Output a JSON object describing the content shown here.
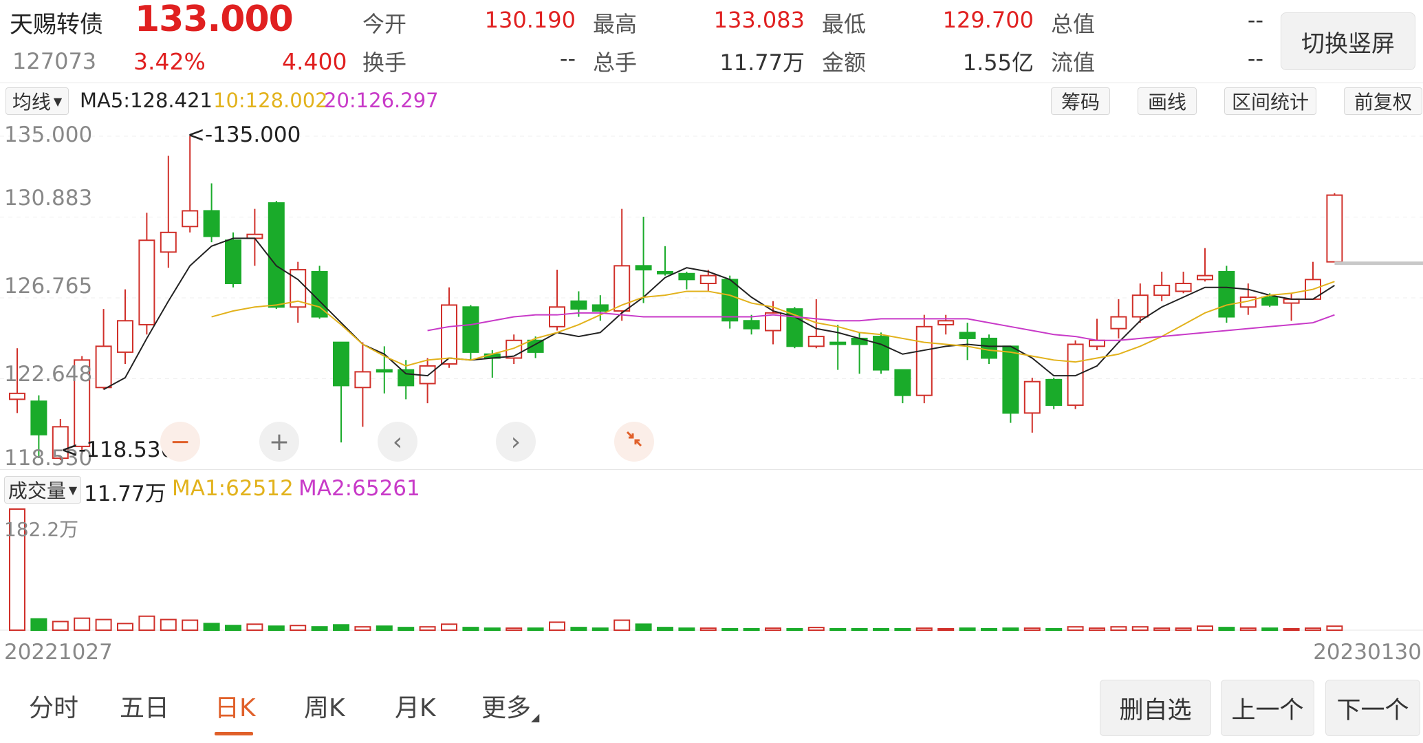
{
  "header": {
    "name": "天赐转债",
    "price": "133.000",
    "code": "127073",
    "change_pct": "3.42%",
    "change_amt": "4.400",
    "switch_label": "切换竖屏",
    "stats_row1": [
      {
        "label": "今开",
        "value": "130.190"
      },
      {
        "label": "最高",
        "value": "133.083"
      },
      {
        "label": "最低",
        "value": "129.700"
      },
      {
        "label": "总值",
        "value": "--"
      }
    ],
    "stats_row2": [
      {
        "label": "换手",
        "value": "--"
      },
      {
        "label": "总手",
        "value": "11.77万"
      },
      {
        "label": "金额",
        "value": "1.55亿"
      },
      {
        "label": "流值",
        "value": "--"
      }
    ]
  },
  "toolbar": {
    "ma_select": "均线",
    "ma5": "MA5:128.421",
    "ma10": "10:128.002",
    "ma20": "20:126.297",
    "chips": "筹码",
    "draw": "画线",
    "range_stats": "区间统计",
    "adjust": "前复权"
  },
  "price_axis": [
    "135.000",
    "130.883",
    "126.765",
    "122.648",
    "118.530"
  ],
  "annotations": {
    "high": "<-135.000",
    "low": "<-118.530"
  },
  "volume_bar": {
    "select": "成交量",
    "total": "11.77万",
    "ma1": "MA1:62512",
    "ma2": "MA2:65261",
    "axis_max": "182.2万"
  },
  "dates": {
    "start": "20221027",
    "end": "20230130"
  },
  "tabs": [
    "分时",
    "五日",
    "日K",
    "周K",
    "月K",
    "更多"
  ],
  "active_tab": "日K",
  "bottom_buttons": {
    "delete": "删自选",
    "prev": "上一个",
    "next": "下一个"
  },
  "colors": {
    "up": "#d0302a",
    "down": "#1aab2a",
    "ma5": "#222222",
    "ma10": "#e2b21c",
    "ma20": "#c83ac8"
  },
  "chart_data": {
    "type": "candlestick",
    "ylim": [
      118.53,
      135.0
    ],
    "volume_max_wan": 182.2,
    "candles": [
      {
        "o": 121.6,
        "c": 121.9,
        "h": 124.2,
        "l": 120.9,
        "v": 182.2
      },
      {
        "o": 121.5,
        "c": 119.8,
        "h": 121.8,
        "l": 118.6,
        "v": 17
      },
      {
        "o": 118.6,
        "c": 120.2,
        "h": 120.6,
        "l": 118.5,
        "v": 13
      },
      {
        "o": 119.2,
        "c": 123.6,
        "h": 123.8,
        "l": 118.8,
        "v": 18
      },
      {
        "o": 122.2,
        "c": 124.3,
        "h": 126.2,
        "l": 122.1,
        "v": 16
      },
      {
        "o": 124.0,
        "c": 125.6,
        "h": 127.2,
        "l": 123.4,
        "v": 10
      },
      {
        "o": 125.4,
        "c": 129.7,
        "h": 131.1,
        "l": 124.9,
        "v": 21
      },
      {
        "o": 129.1,
        "c": 130.1,
        "h": 134.0,
        "l": 128.3,
        "v": 16
      },
      {
        "o": 130.4,
        "c": 131.2,
        "h": 135.0,
        "l": 130.1,
        "v": 15
      },
      {
        "o": 131.2,
        "c": 129.9,
        "h": 132.6,
        "l": 129.6,
        "v": 10
      },
      {
        "o": 129.7,
        "c": 127.5,
        "h": 130.1,
        "l": 127.3,
        "v": 7
      },
      {
        "o": 129.8,
        "c": 130.0,
        "h": 131.3,
        "l": 128.4,
        "v": 9
      },
      {
        "o": 131.6,
        "c": 126.3,
        "h": 131.7,
        "l": 126.2,
        "v": 6
      },
      {
        "o": 126.3,
        "c": 128.2,
        "h": 128.6,
        "l": 125.5,
        "v": 7
      },
      {
        "o": 128.1,
        "c": 125.8,
        "h": 128.4,
        "l": 125.7,
        "v": 5
      },
      {
        "o": 124.5,
        "c": 122.3,
        "h": 124.5,
        "l": 119.4,
        "v": 8
      },
      {
        "o": 122.2,
        "c": 123.0,
        "h": 124.5,
        "l": 120.2,
        "v": 5
      },
      {
        "o": 123.1,
        "c": 123.0,
        "h": 124.3,
        "l": 121.9,
        "v": 6
      },
      {
        "o": 123.1,
        "c": 122.3,
        "h": 123.6,
        "l": 121.6,
        "v": 4
      },
      {
        "o": 122.4,
        "c": 123.3,
        "h": 123.7,
        "l": 121.4,
        "v": 5
      },
      {
        "o": 123.4,
        "c": 126.4,
        "h": 127.3,
        "l": 123.2,
        "v": 9
      },
      {
        "o": 126.3,
        "c": 124.0,
        "h": 126.4,
        "l": 123.6,
        "v": 4
      },
      {
        "o": 123.9,
        "c": 123.7,
        "h": 124.1,
        "l": 122.7,
        "v": 3
      },
      {
        "o": 123.7,
        "c": 124.6,
        "h": 124.9,
        "l": 123.4,
        "v": 3
      },
      {
        "o": 124.6,
        "c": 124.0,
        "h": 124.8,
        "l": 123.7,
        "v": 3
      },
      {
        "o": 125.3,
        "c": 126.3,
        "h": 128.2,
        "l": 125.1,
        "v": 12
      },
      {
        "o": 126.6,
        "c": 126.2,
        "h": 127.1,
        "l": 125.8,
        "v": 4
      },
      {
        "o": 126.4,
        "c": 126.1,
        "h": 126.9,
        "l": 125.6,
        "v": 3
      },
      {
        "o": 126.1,
        "c": 128.4,
        "h": 131.3,
        "l": 125.6,
        "v": 15
      },
      {
        "o": 128.4,
        "c": 128.2,
        "h": 130.9,
        "l": 126.5,
        "v": 9
      },
      {
        "o": 128.1,
        "c": 128.0,
        "h": 129.4,
        "l": 127.9,
        "v": 4
      },
      {
        "o": 128.0,
        "c": 127.7,
        "h": 128.1,
        "l": 127.2,
        "v": 3
      },
      {
        "o": 127.5,
        "c": 127.9,
        "h": 128.2,
        "l": 127.1,
        "v": 3
      },
      {
        "o": 127.7,
        "c": 125.6,
        "h": 127.9,
        "l": 125.2,
        "v": 2
      },
      {
        "o": 125.6,
        "c": 125.2,
        "h": 125.9,
        "l": 124.9,
        "v": 2
      },
      {
        "o": 125.1,
        "c": 126.0,
        "h": 126.6,
        "l": 124.4,
        "v": 3
      },
      {
        "o": 126.2,
        "c": 124.3,
        "h": 126.3,
        "l": 124.2,
        "v": 2
      },
      {
        "o": 124.3,
        "c": 124.8,
        "h": 126.7,
        "l": 124.2,
        "v": 4
      },
      {
        "o": 124.5,
        "c": 124.4,
        "h": 125.4,
        "l": 123.1,
        "v": 2
      },
      {
        "o": 124.7,
        "c": 124.4,
        "h": 125.0,
        "l": 122.9,
        "v": 2
      },
      {
        "o": 124.8,
        "c": 123.1,
        "h": 125.0,
        "l": 122.9,
        "v": 2
      },
      {
        "o": 123.1,
        "c": 121.8,
        "h": 123.1,
        "l": 121.4,
        "v": 2
      },
      {
        "o": 121.8,
        "c": 125.3,
        "h": 125.9,
        "l": 121.4,
        "v": 3
      },
      {
        "o": 125.4,
        "c": 125.6,
        "h": 125.9,
        "l": 124.9,
        "v": 2
      },
      {
        "o": 125.0,
        "c": 124.7,
        "h": 125.5,
        "l": 123.6,
        "v": 3
      },
      {
        "o": 124.7,
        "c": 123.7,
        "h": 124.9,
        "l": 123.4,
        "v": 2
      },
      {
        "o": 124.3,
        "c": 120.9,
        "h": 124.3,
        "l": 120.4,
        "v": 3
      },
      {
        "o": 120.9,
        "c": 122.5,
        "h": 122.7,
        "l": 119.9,
        "v": 3
      },
      {
        "o": 122.6,
        "c": 121.3,
        "h": 122.7,
        "l": 121.1,
        "v": 2
      },
      {
        "o": 121.3,
        "c": 124.4,
        "h": 124.6,
        "l": 121.1,
        "v": 5
      },
      {
        "o": 124.3,
        "c": 124.6,
        "h": 125.7,
        "l": 124.1,
        "v": 3
      },
      {
        "o": 125.2,
        "c": 125.8,
        "h": 126.7,
        "l": 124.7,
        "v": 5
      },
      {
        "o": 125.8,
        "c": 126.9,
        "h": 127.5,
        "l": 125.5,
        "v": 5
      },
      {
        "o": 126.9,
        "c": 127.4,
        "h": 128.1,
        "l": 126.6,
        "v": 3
      },
      {
        "o": 127.1,
        "c": 127.5,
        "h": 128.1,
        "l": 127.0,
        "v": 3
      },
      {
        "o": 127.7,
        "c": 127.9,
        "h": 129.3,
        "l": 127.6,
        "v": 6
      },
      {
        "o": 128.1,
        "c": 125.8,
        "h": 128.4,
        "l": 125.5,
        "v": 4
      },
      {
        "o": 126.3,
        "c": 126.8,
        "h": 127.5,
        "l": 125.9,
        "v": 3
      },
      {
        "o": 126.8,
        "c": 126.4,
        "h": 127.0,
        "l": 126.3,
        "v": 3
      },
      {
        "o": 126.5,
        "c": 126.7,
        "h": 127.0,
        "l": 125.6,
        "v": 2
      },
      {
        "o": 126.7,
        "c": 127.7,
        "h": 128.6,
        "l": 126.7,
        "v": 3
      },
      {
        "o": 128.6,
        "c": 132.0,
        "h": 132.1,
        "l": 128.6,
        "v": 6
      }
    ],
    "ma5": [
      null,
      null,
      null,
      null,
      122.1,
      122.7,
      124.7,
      126.6,
      128.4,
      129.4,
      129.8,
      129.8,
      128.4,
      127.7,
      126.6,
      125.5,
      124.4,
      123.9,
      122.9,
      122.8,
      123.7,
      123.6,
      123.7,
      123.8,
      124.4,
      125.0,
      124.8,
      125.0,
      126.0,
      126.8,
      127.8,
      128.3,
      128.1,
      127.7,
      126.8,
      126.1,
      125.8,
      125.2,
      125.0,
      124.7,
      124.4,
      123.9,
      124.1,
      124.3,
      124.4,
      124.3,
      124.3,
      123.7,
      122.8,
      122.8,
      123.3,
      124.5,
      125.6,
      126.3,
      126.8,
      127.3,
      127.3,
      127.2,
      126.9,
      126.7,
      126.7,
      127.4
    ],
    "ma10": [
      null,
      null,
      null,
      null,
      null,
      null,
      null,
      null,
      null,
      125.8,
      126.1,
      126.3,
      126.4,
      126.6,
      126.3,
      125.4,
      124.4,
      123.8,
      123.3,
      123.6,
      123.7,
      123.6,
      123.9,
      124.2,
      124.7,
      125.0,
      125.4,
      125.9,
      126.4,
      126.8,
      126.9,
      127.1,
      127.1,
      126.9,
      126.5,
      126.3,
      125.9,
      125.5,
      125.3,
      125.0,
      124.9,
      124.7,
      124.5,
      124.4,
      124.3,
      124.1,
      124.0,
      123.8,
      123.6,
      123.5,
      123.7,
      123.9,
      124.3,
      124.8,
      125.4,
      126.0,
      126.4,
      126.6,
      126.9,
      127.0,
      127.2,
      127.6
    ],
    "ma20": [
      null,
      null,
      null,
      null,
      null,
      null,
      null,
      null,
      null,
      null,
      null,
      null,
      null,
      null,
      null,
      null,
      null,
      null,
      null,
      125.1,
      125.3,
      125.4,
      125.6,
      125.8,
      125.9,
      125.9,
      126.0,
      126.0,
      125.9,
      125.8,
      125.8,
      125.8,
      125.8,
      125.8,
      125.8,
      125.9,
      125.8,
      125.7,
      125.6,
      125.6,
      125.7,
      125.7,
      125.7,
      125.7,
      125.7,
      125.5,
      125.3,
      125.1,
      124.9,
      124.8,
      124.6,
      124.6,
      124.7,
      124.8,
      124.9,
      125.0,
      125.1,
      125.2,
      125.3,
      125.4,
      125.5,
      125.9
    ]
  }
}
